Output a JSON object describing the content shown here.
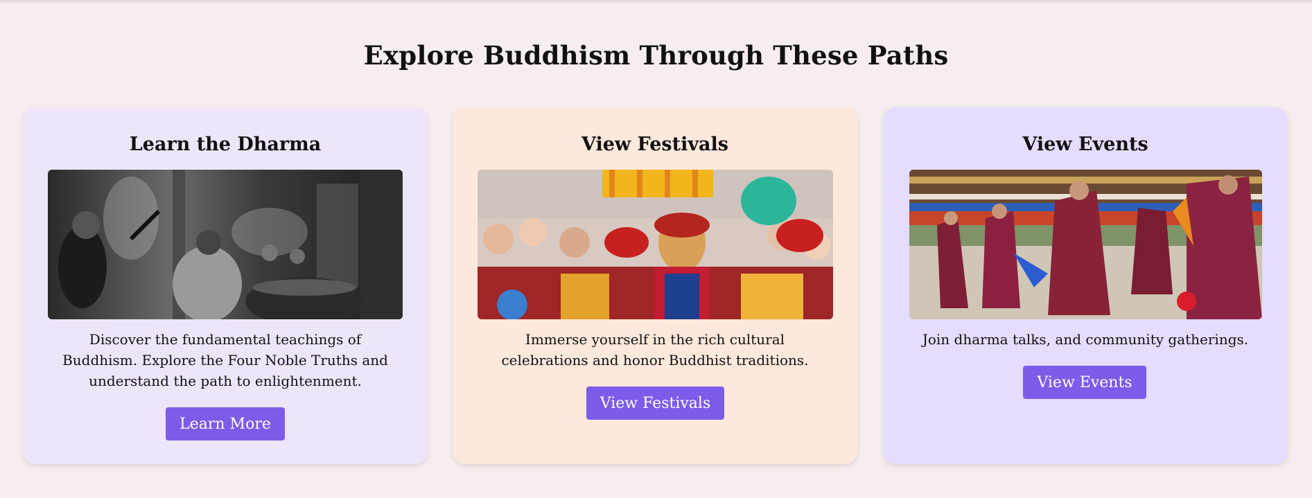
{
  "section": {
    "title": "Explore Buddhism Through These Paths"
  },
  "cards": [
    {
      "title": "Learn the Dharma",
      "image_icon": "temple-incense-photo",
      "description": "Discover the fundamental teachings of Buddhism. Explore the Four Noble Truths and understand the path to enlightenment.",
      "button_label": "Learn More",
      "background": "#efe5f9"
    },
    {
      "title": "View Festivals",
      "image_icon": "masked-festival-crowd-photo",
      "description": "Immerse yourself in the rich cultural celebrations and honor Buddhist traditions.",
      "button_label": "View Festivals",
      "background": "#fde8dc"
    },
    {
      "title": "View Events",
      "image_icon": "monk-dance-photo",
      "description": "Join dharma talks, and community gatherings.",
      "button_label": "View Events",
      "background": "#e6dcfd"
    }
  ],
  "colors": {
    "page_background": "#f6eeee",
    "button": "#7c5ce8",
    "button_text": "#ffffff"
  }
}
